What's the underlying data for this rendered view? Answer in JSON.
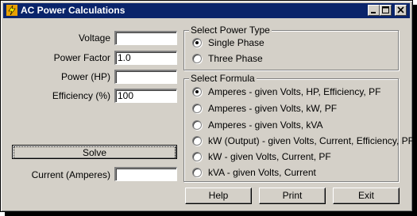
{
  "window": {
    "title": "AC Power Calculations",
    "icon": "app-icon",
    "controls": [
      "minimize-icon",
      "maximize-icon",
      "close-icon"
    ]
  },
  "inputs": {
    "voltage": {
      "label": "Voltage",
      "value": ""
    },
    "power_factor": {
      "label": "Power Factor",
      "value": "1.0"
    },
    "power_hp": {
      "label": "Power (HP)",
      "value": ""
    },
    "efficiency": {
      "label": "Efficiency (%)",
      "value": "100"
    }
  },
  "solve_button": {
    "label": "Solve"
  },
  "result": {
    "label": "Current (Amperes)",
    "value": ""
  },
  "power_type": {
    "title": "Select Power Type",
    "options": [
      {
        "label": "Single Phase",
        "selected": true
      },
      {
        "label": "Three Phase",
        "selected": false
      }
    ]
  },
  "formula": {
    "title": "Select Formula",
    "options": [
      {
        "label": "Amperes - given Volts, HP, Efficiency, PF",
        "selected": true
      },
      {
        "label": "Amperes - given Volts, kW, PF",
        "selected": false
      },
      {
        "label": "Amperes - given Volts, kVA",
        "selected": false
      },
      {
        "label": "kW (Output) - given Volts, Current, Efficiency, PF",
        "selected": false
      },
      {
        "label": "kW - given Volts, Current, PF",
        "selected": false
      },
      {
        "label": "kVA - given Volts, Current",
        "selected": false
      }
    ]
  },
  "footer_buttons": {
    "help": "Help",
    "print": "Print",
    "exit": "Exit"
  },
  "colors": {
    "titlebar": "#0a246a",
    "face": "#d4d0c8"
  }
}
